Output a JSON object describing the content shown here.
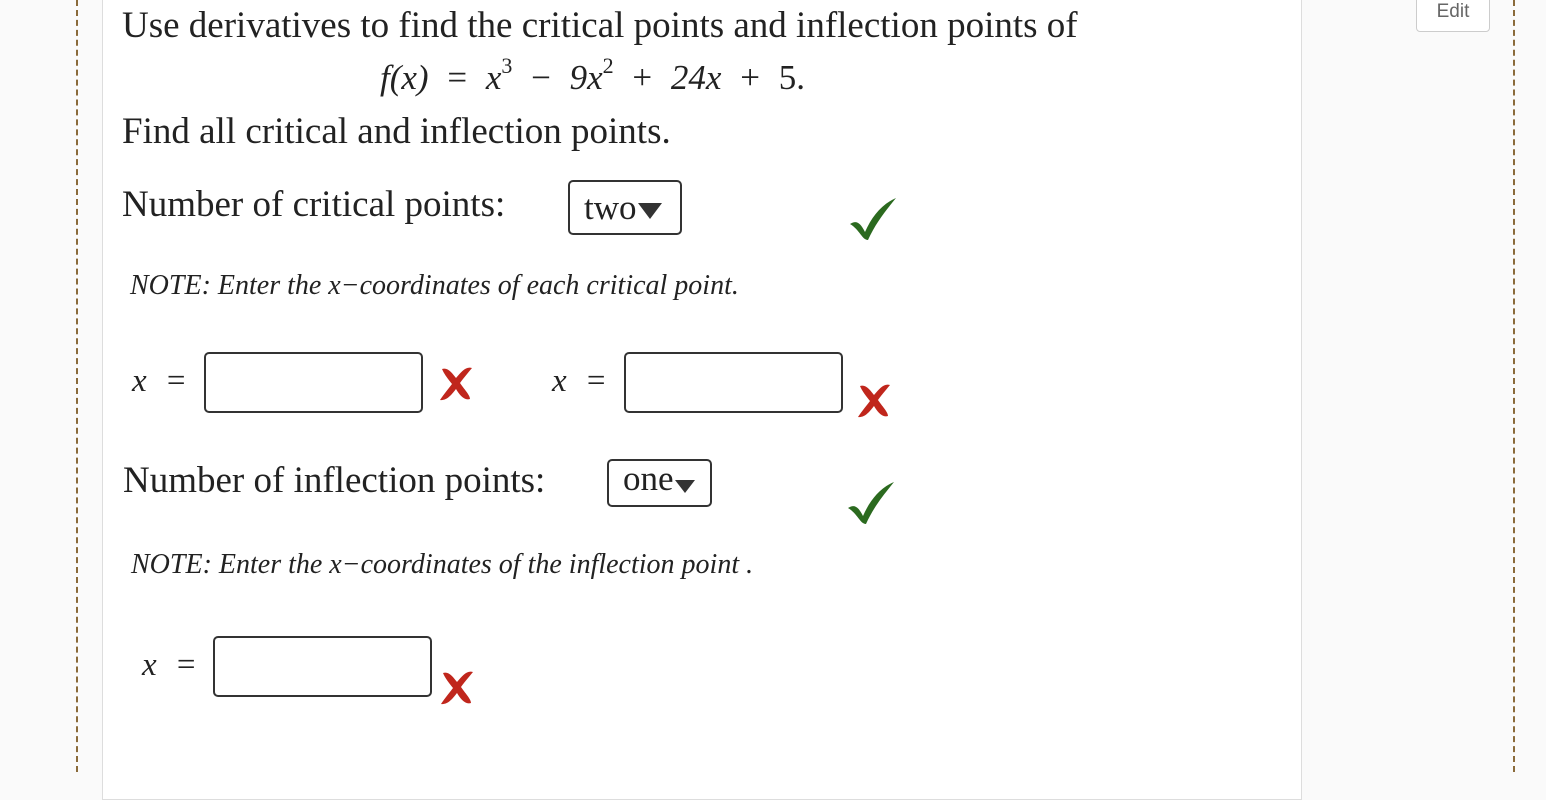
{
  "edit_button_label": "Edit",
  "question": {
    "intro": "Use derivatives to find the critical points and inflection points of",
    "function_lhs": "f(x)",
    "equals": "=",
    "term1_base": "x",
    "term1_exp": "3",
    "op1": "−",
    "term2_base": "9x",
    "term2_exp": "2",
    "op2": "+",
    "term3": "24x",
    "op3": "+",
    "term4": "5.",
    "instruction": "Find all critical and inflection points."
  },
  "critical": {
    "label": "Number of critical points:",
    "selected_value": "two",
    "status": "correct",
    "note": "NOTE: Enter the x−coordinates of each critical point.",
    "inputs": [
      {
        "label_var": "x",
        "label_eq": "=",
        "value": "",
        "status": "incorrect"
      },
      {
        "label_var": "x",
        "label_eq": "=",
        "value": "",
        "status": "incorrect"
      }
    ]
  },
  "inflection": {
    "label": "Number of inflection points:",
    "selected_value": "one",
    "status": "correct",
    "note": "NOTE: Enter the x−coordinates of the inflection point .",
    "inputs": [
      {
        "label_var": "x",
        "label_eq": "=",
        "value": "",
        "status": "incorrect"
      }
    ]
  },
  "colors": {
    "correct": "#2b6a1f",
    "incorrect": "#c0261c"
  },
  "icons": {
    "correct": "check-icon",
    "incorrect": "cross-icon"
  }
}
